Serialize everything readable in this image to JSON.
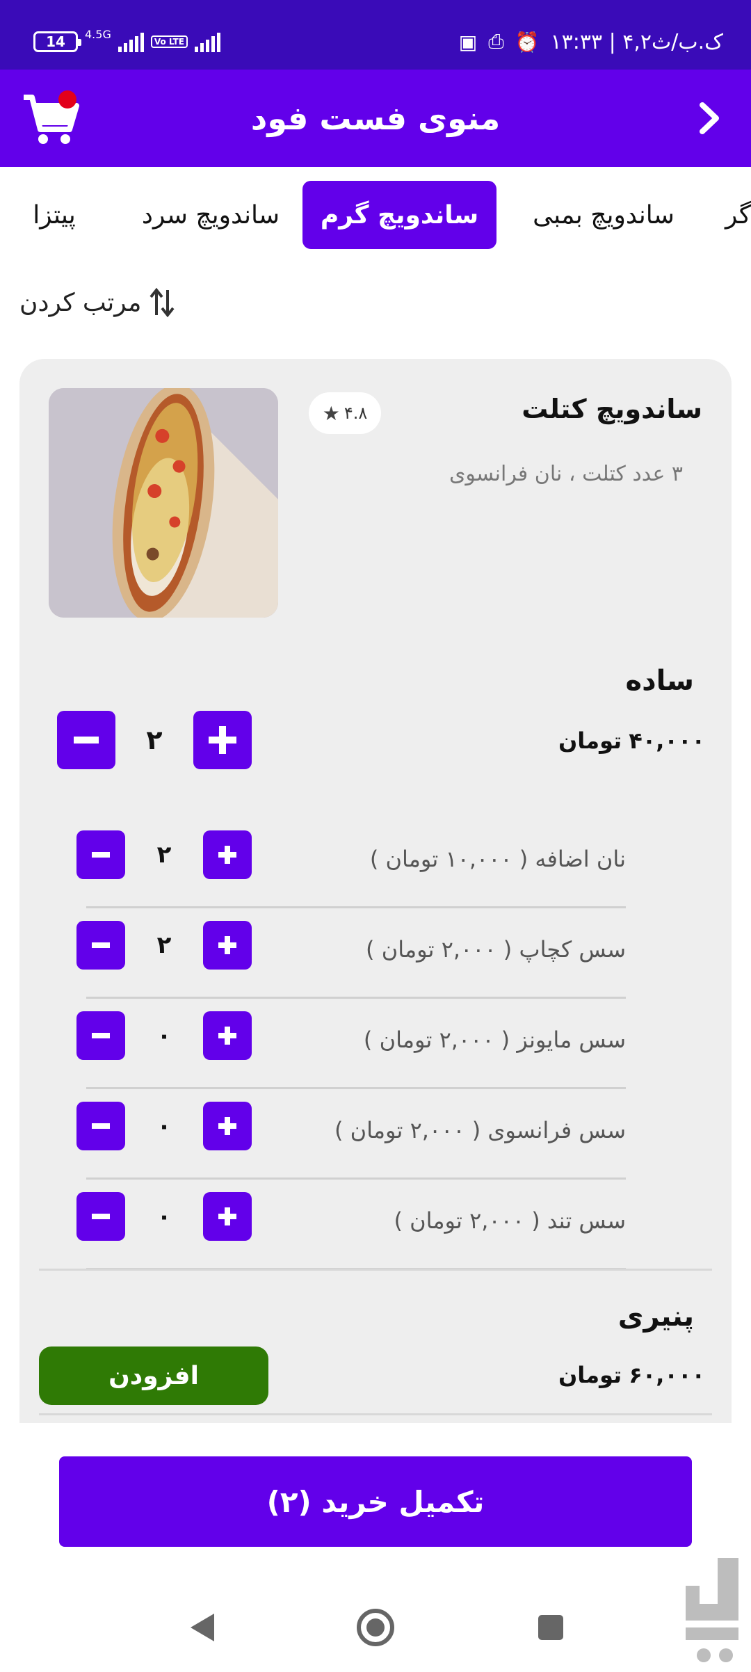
{
  "status_bar": {
    "time": "۱۳:۳۳ | ۴,۲ک.ب/ث",
    "battery": "14",
    "network": "4.5G",
    "volte": "Vo LTE"
  },
  "app_bar": {
    "title": "منوی فست فود"
  },
  "tabs": [
    {
      "label": "پیتزا",
      "active": false
    },
    {
      "label": "ساندویچ سرد",
      "active": false
    },
    {
      "label": "ساندویچ گرم",
      "active": true
    },
    {
      "label": "ساندویچ بمبی",
      "active": false
    },
    {
      "label": "گر",
      "active": false
    }
  ],
  "sort": {
    "label": "مرتب کردن"
  },
  "item": {
    "title": "ساندویچ کتلت",
    "description": "۳ عدد کتلت ، نان فرانسوی",
    "rating": "۴.۸"
  },
  "variants": [
    {
      "name": "ساده",
      "price": "۴۰,۰۰۰",
      "currency": "تومان",
      "quantity": "۲",
      "addons": [
        {
          "label": "نان اضافه ( ۱۰,۰۰۰ تومان )",
          "quantity": "۲"
        },
        {
          "label": "سس کچاپ ( ۲,۰۰۰ تومان )",
          "quantity": "۲"
        },
        {
          "label": "سس مایونز ( ۲,۰۰۰ تومان )",
          "quantity": "۰"
        },
        {
          "label": "سس فرانسوی ( ۲,۰۰۰ تومان )",
          "quantity": "۰"
        },
        {
          "label": "سس تند ( ۲,۰۰۰ تومان )",
          "quantity": "۰"
        }
      ]
    },
    {
      "name": "پنیری",
      "price": "۶۰,۰۰۰",
      "currency": "تومان",
      "add_label": "افزودن"
    }
  ],
  "checkout": {
    "label": "تکمیل خرید (۲)"
  },
  "colors": {
    "primary": "#6200ea",
    "status_bar": "#3a0bb8",
    "add_button": "#2f7a05",
    "cart_badge": "#e2001a"
  }
}
